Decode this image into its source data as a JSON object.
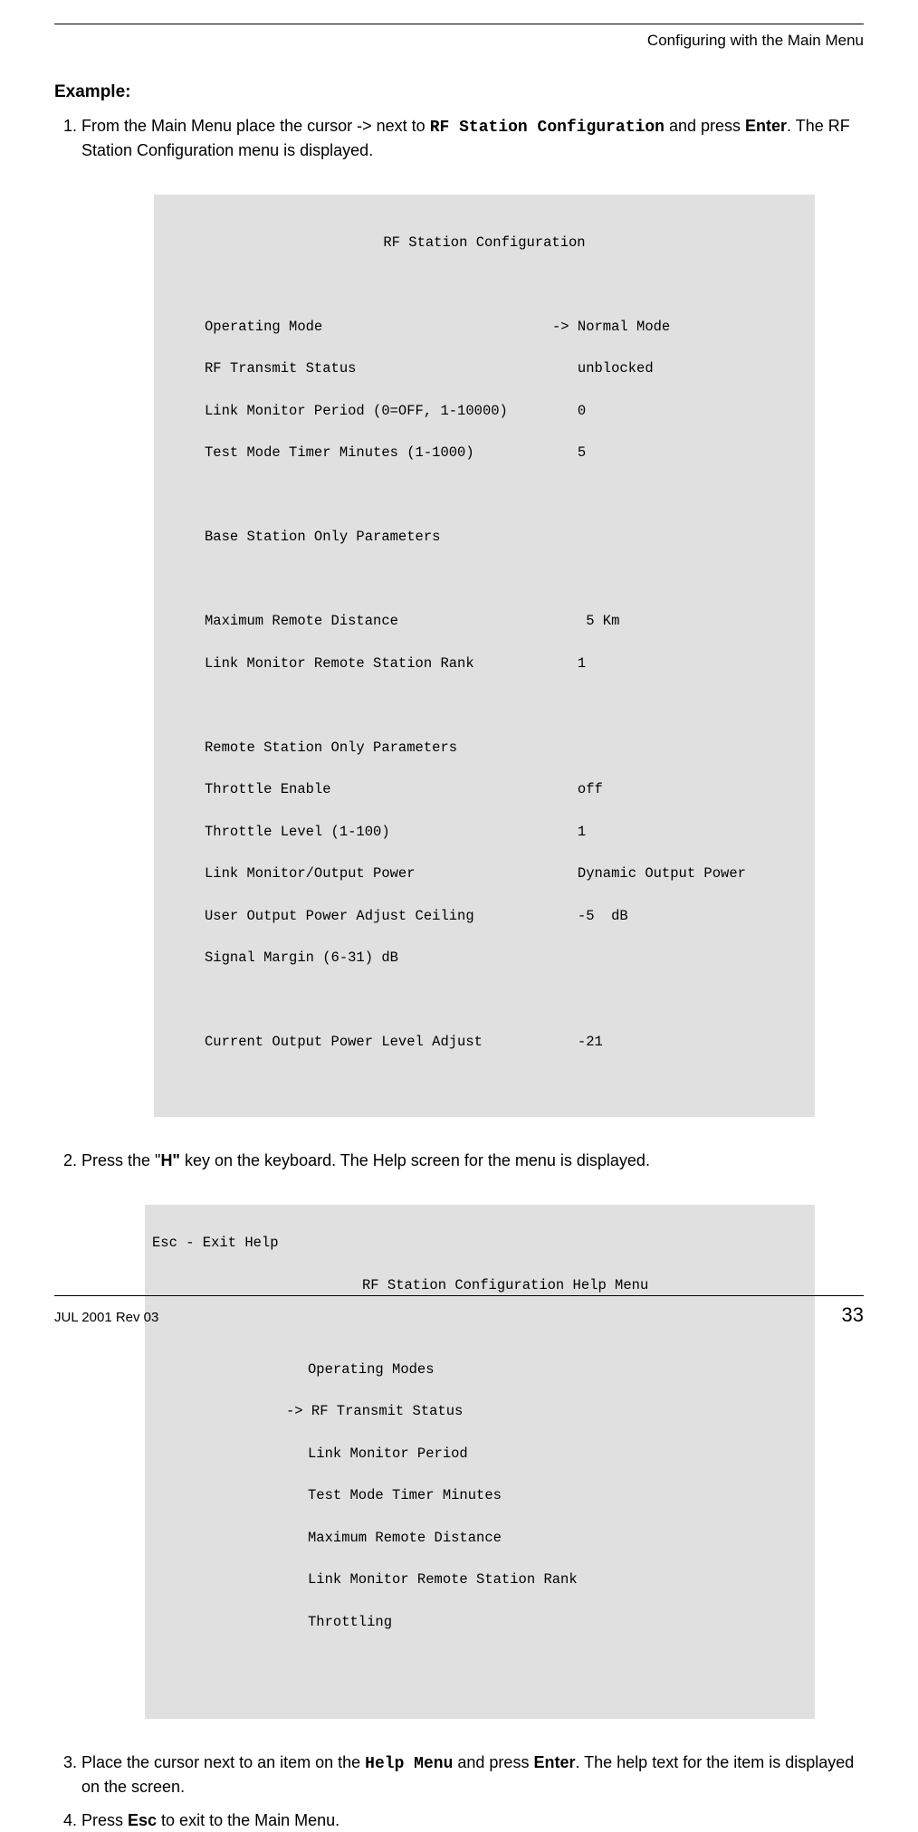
{
  "header": {
    "right": "Configuring with the Main Menu"
  },
  "labels": {
    "example": "Example:"
  },
  "steps": {
    "s1": {
      "prefix": "From the Main Menu place the cursor ",
      "arrow": "->",
      "mid1": " next to ",
      "mono": "RF Station Configuration",
      "mid2": " and press ",
      "enter": "Enter",
      "suffix": ". The RF Station Configuration menu is displayed."
    },
    "s2": {
      "prefix": "Press the \"",
      "key": "H\"",
      "suffix": " key on the keyboard. The Help screen for the menu is displayed."
    },
    "s3": {
      "prefix": "Place the cursor next to an item on the ",
      "mono": "Help Menu",
      "mid": " and press ",
      "enter": "Enter",
      "suffix": ". The help text for the item is displayed on the screen."
    },
    "s4": {
      "prefix": "Press ",
      "key": "Esc",
      "suffix": " to exit to the Main Menu."
    }
  },
  "block1": {
    "title": "RF Station Configuration",
    "rows": [
      {
        "l": "Operating Mode",
        "r": "-> Normal Mode"
      },
      {
        "l": "RF Transmit Status",
        "r": "   unblocked"
      },
      {
        "l": "Link Monitor Period (0=OFF, 1-10000)",
        "r": "   0"
      },
      {
        "l": "Test Mode Timer Minutes (1-1000)",
        "r": "   5"
      }
    ],
    "sect1": "Base Station Only Parameters",
    "rows2": [
      {
        "l": "Maximum Remote Distance",
        "r": "    5 Km"
      },
      {
        "l": "Link Monitor Remote Station Rank",
        "r": "   1"
      }
    ],
    "sect2": "Remote Station Only Parameters",
    "rows3": [
      {
        "l": "Throttle Enable",
        "r": "   off"
      },
      {
        "l": "Throttle Level (1-100)",
        "r": "   1"
      },
      {
        "l": "Link Monitor/Output Power",
        "r": "   Dynamic Output Power"
      },
      {
        "l": "User Output Power Adjust Ceiling",
        "r": "   -5  dB"
      },
      {
        "l": "Signal Margin (6-31) dB",
        "r": ""
      }
    ],
    "rows4": [
      {
        "l": "Current Output Power Level Adjust",
        "r": "   -21"
      }
    ]
  },
  "block2": {
    "esc": "Esc - Exit Help",
    "title": "RF Station Configuration Help Menu",
    "items": [
      "Operating Modes",
      "RF Transmit Status",
      "Link Monitor Period",
      "Test Mode Timer Minutes",
      "Maximum Remote Distance",
      "Link Monitor Remote Station Rank",
      "Throttling"
    ],
    "arrow": "-> "
  },
  "footer": {
    "left": "JUL 2001 Rev 03",
    "right": "33"
  }
}
